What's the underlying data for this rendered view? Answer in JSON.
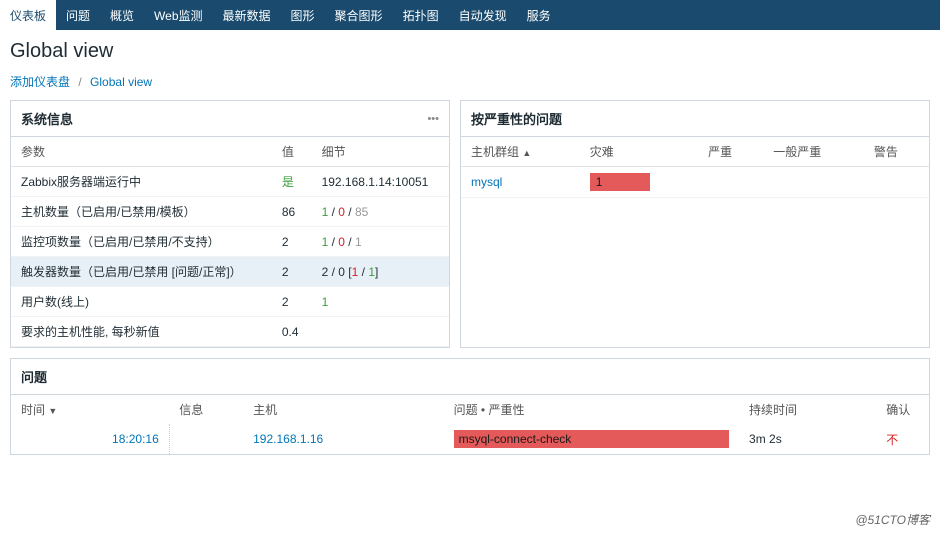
{
  "nav": {
    "items": [
      {
        "label": "仪表板",
        "active": true
      },
      {
        "label": "问题"
      },
      {
        "label": "概览"
      },
      {
        "label": "Web监测"
      },
      {
        "label": "最新数据"
      },
      {
        "label": "图形"
      },
      {
        "label": "聚合图形"
      },
      {
        "label": "拓扑图"
      },
      {
        "label": "自动发现"
      },
      {
        "label": "服务"
      }
    ]
  },
  "page": {
    "title": "Global view"
  },
  "breadcrumb": {
    "item1": "添加仪表盘",
    "item2": "Global view"
  },
  "sysinfo": {
    "title": "系统信息",
    "col_param": "参数",
    "col_value": "值",
    "col_detail": "细节",
    "controls": "•••",
    "rows": [
      {
        "param": "Zabbix服务器端运行中",
        "value": "是",
        "value_class": "val-green",
        "detail": "192.168.1.14:10051"
      },
      {
        "param": "主机数量（已启用/已禁用/模板）",
        "value": "86",
        "detail_parts": [
          "1",
          " / ",
          "0",
          " / ",
          "85"
        ],
        "detail_classes": [
          "val-green",
          "",
          "val-red",
          "",
          "val-gray"
        ]
      },
      {
        "param": "监控项数量（已启用/已禁用/不支持）",
        "value": "2",
        "detail_parts": [
          "1",
          " / ",
          "0",
          " / ",
          "1"
        ],
        "detail_classes": [
          "val-green",
          "",
          "val-red",
          "",
          "val-gray"
        ]
      },
      {
        "param": "触发器数量（已启用/已禁用 [问题/正常]）",
        "value": "2",
        "detail_parts": [
          "2 / 0 [",
          "1",
          " / ",
          "1",
          "]"
        ],
        "detail_classes": [
          "",
          "val-red",
          "",
          "val-green",
          ""
        ],
        "highlighted": true
      },
      {
        "param": "用户数(线上)",
        "value": "2",
        "detail": "1",
        "detail_class": "val-green"
      },
      {
        "param": "要求的主机性能, 每秒新值",
        "value": "0.4",
        "detail": ""
      }
    ]
  },
  "severity": {
    "title": "按严重性的问题",
    "col_hostgroup": "主机群组",
    "col_disaster": "灾难",
    "col_high": "严重",
    "col_average": "一般严重",
    "col_warning": "警告",
    "rows": [
      {
        "hostgroup": "mysql",
        "disaster": "1"
      }
    ]
  },
  "problems": {
    "title": "问题",
    "col_time": "时间",
    "col_info": "信息",
    "col_host": "主机",
    "col_problem": "问题 • 严重性",
    "col_duration": "持续时间",
    "col_ack": "确认",
    "rows": [
      {
        "time": "18:20:16",
        "info": "",
        "host": "192.168.1.16",
        "problem": "msyql-connect-check",
        "duration": "3m 2s",
        "ack": "不"
      }
    ]
  },
  "watermark": "@51CTO博客"
}
